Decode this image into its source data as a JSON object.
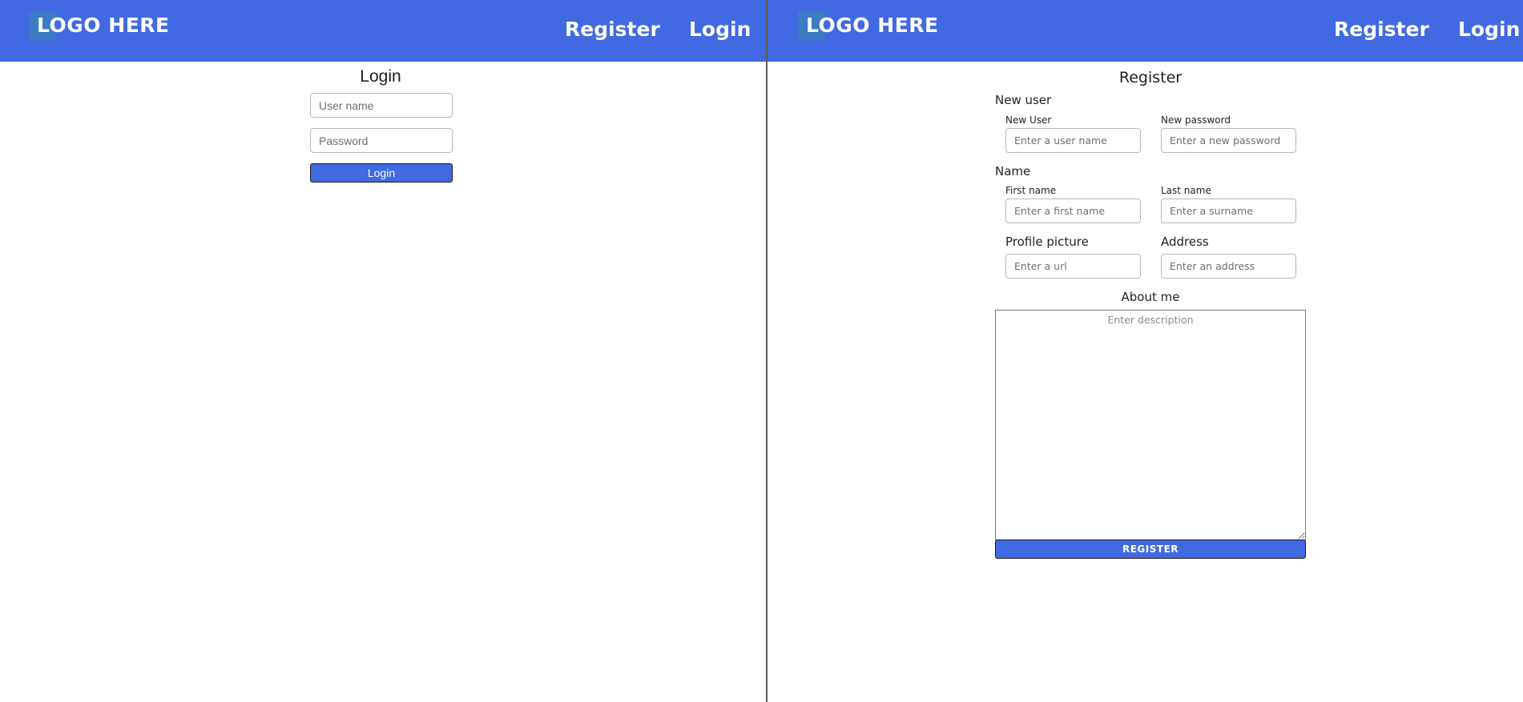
{
  "colors": {
    "navbar_background": "#4169e1",
    "logo_mark": "#3b7cc4",
    "button_background": "#4169e1",
    "divider": "#5a5a5a"
  },
  "login_window": {
    "navbar": {
      "logo_text": "LOGO HERE",
      "nav_register": "Register",
      "nav_login": "Login"
    },
    "form": {
      "title": "Login",
      "username_placeholder": "User name",
      "password_placeholder": "Password",
      "submit_label": "Login"
    }
  },
  "register_window": {
    "navbar": {
      "logo_text": "LOGO HERE",
      "nav_register": "Register",
      "nav_login": "Login"
    },
    "form": {
      "title": "Register",
      "new_user_section": "New user",
      "new_user_label": "New User",
      "new_user_placeholder": "Enter a user name",
      "new_password_label": "New password",
      "new_password_placeholder": "Enter a new password",
      "name_section": "Name",
      "first_name_label": "First name",
      "first_name_placeholder": "Enter a first name",
      "last_name_label": "Last name",
      "last_name_placeholder": "Enter a surname",
      "profile_picture_label": "Profile picture",
      "profile_picture_placeholder": "Enter a url",
      "address_label": "Address",
      "address_placeholder": "Enter an address",
      "about_me_label": "About me",
      "about_me_placeholder": "Enter description",
      "submit_label": "REGISTER"
    }
  }
}
